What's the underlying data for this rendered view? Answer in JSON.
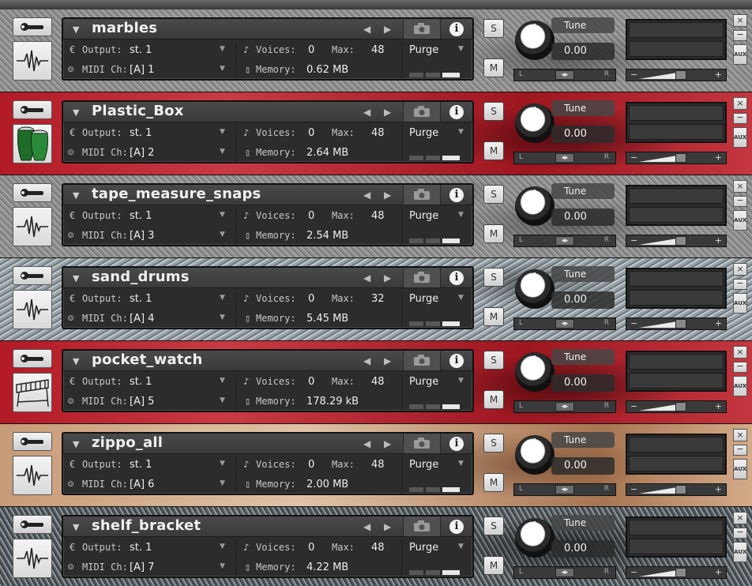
{
  "labels": {
    "output": "Output:",
    "voices": "Voices:",
    "max": "Max:",
    "midi": "MIDI Ch:",
    "memory": "Memory:",
    "purge": "Purge",
    "tune": "Tune",
    "solo": "S",
    "mute": "M",
    "pan_left": "L",
    "pan_right": "R",
    "vol_minus": "−",
    "vol_plus": "+",
    "aux": "AUX",
    "close": "×",
    "minimize": "−"
  },
  "instruments": [
    {
      "name": "marbles",
      "output": "st. 1",
      "voices": "0",
      "max": "48",
      "midi": "[A]  1",
      "memory": "0.62 MB",
      "tune": "0.00",
      "icon": "waveform-icon",
      "background": "grey-grunge"
    },
    {
      "name": "Plastic_Box",
      "output": "st. 1",
      "voices": "0",
      "max": "48",
      "midi": "[A]  2",
      "memory": "2.64 MB",
      "tune": "0.00",
      "icon": "conga-drums-icon",
      "background": "red-grunge"
    },
    {
      "name": "tape_measure_snaps",
      "output": "st. 1",
      "voices": "0",
      "max": "48",
      "midi": "[A]  3",
      "memory": "2.54 MB",
      "tune": "0.00",
      "icon": "waveform-icon",
      "background": "grey-grunge"
    },
    {
      "name": "sand_drums",
      "output": "st. 1",
      "voices": "0",
      "max": "32",
      "midi": "[A]  4",
      "memory": "5.45 MB",
      "tune": "0.00",
      "icon": "waveform-icon",
      "background": "slate-grunge"
    },
    {
      "name": "pocket_watch",
      "output": "st. 1",
      "voices": "0",
      "max": "48",
      "midi": "[A]  5",
      "memory": "178.29 kB",
      "tune": "0.00",
      "icon": "marimba-icon",
      "background": "red-grunge"
    },
    {
      "name": "zippo_all",
      "output": "st. 1",
      "voices": "0",
      "max": "48",
      "midi": "[A]  6",
      "memory": "2.00 MB",
      "tune": "0.00",
      "icon": "waveform-icon",
      "background": "rust-grunge"
    },
    {
      "name": "shelf_bracket",
      "output": "st. 1",
      "voices": "0",
      "max": "48",
      "midi": "[A]  7",
      "memory": "4.22 MB",
      "tune": "0.00",
      "icon": "waveform-icon",
      "background": "dark-grunge"
    }
  ]
}
